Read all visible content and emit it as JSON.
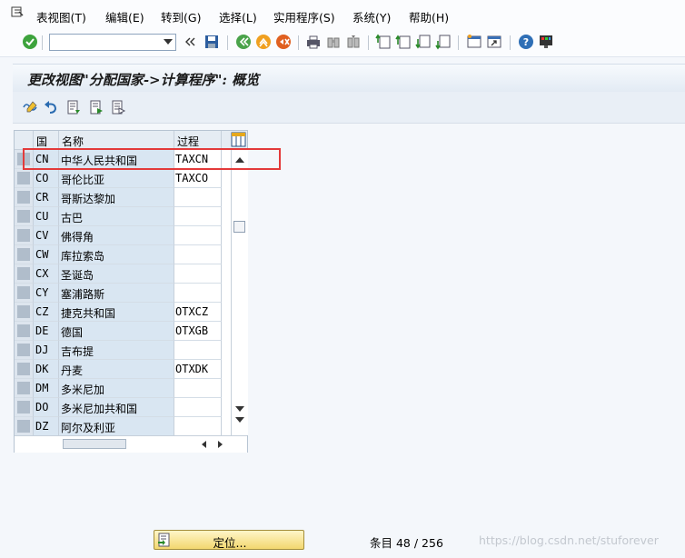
{
  "menu": {
    "items": [
      "表视图(T)",
      "编辑(E)",
      "转到(G)",
      "选择(L)",
      "实用程序(S)",
      "系统(Y)",
      "帮助(H)"
    ]
  },
  "toolbar": {
    "command_value": "",
    "icons": [
      "enter-check-icon",
      "save-icon",
      "back-icon",
      "exit-icon",
      "cancel-icon",
      "print-icon",
      "find-icon",
      "find-next-icon",
      "first-page-icon",
      "prev-page-icon",
      "next-page-icon",
      "last-page-icon",
      "new-session-icon",
      "shortcut-icon",
      "help-icon",
      "customize-layout-icon"
    ]
  },
  "title": "更改视图\"分配国家->计算程序\": 概览",
  "table": {
    "headers": {
      "country": "国",
      "name": "名称",
      "procedure": "过程"
    },
    "rows": [
      {
        "code": "CN",
        "name": "中华人民共和国",
        "proc": "TAXCN"
      },
      {
        "code": "CO",
        "name": "哥伦比亚",
        "proc": "TAXCO"
      },
      {
        "code": "CR",
        "name": "哥斯达黎加",
        "proc": ""
      },
      {
        "code": "CU",
        "name": "古巴",
        "proc": ""
      },
      {
        "code": "CV",
        "name": "佛得角",
        "proc": ""
      },
      {
        "code": "CW",
        "name": "库拉索岛",
        "proc": ""
      },
      {
        "code": "CX",
        "name": "圣诞岛",
        "proc": ""
      },
      {
        "code": "CY",
        "name": "塞浦路斯",
        "proc": ""
      },
      {
        "code": "CZ",
        "name": "捷克共和国",
        "proc": "OTXCZ"
      },
      {
        "code": "DE",
        "name": "德国",
        "proc": "OTXGB"
      },
      {
        "code": "DJ",
        "name": "吉布提",
        "proc": ""
      },
      {
        "code": "DK",
        "name": "丹麦",
        "proc": "OTXDK"
      },
      {
        "code": "DM",
        "name": "多米尼加",
        "proc": ""
      },
      {
        "code": "DO",
        "name": "多米尼加共和国",
        "proc": ""
      },
      {
        "code": "DZ",
        "name": "阿尔及利亚",
        "proc": ""
      }
    ]
  },
  "footer": {
    "position_button": "定位...",
    "entries": "条目 48 / 256",
    "watermark": "https://blog.csdn.net/stuforever"
  },
  "colors": {
    "highlight": "#e33a3a",
    "title_text": "#1a1a1a"
  }
}
